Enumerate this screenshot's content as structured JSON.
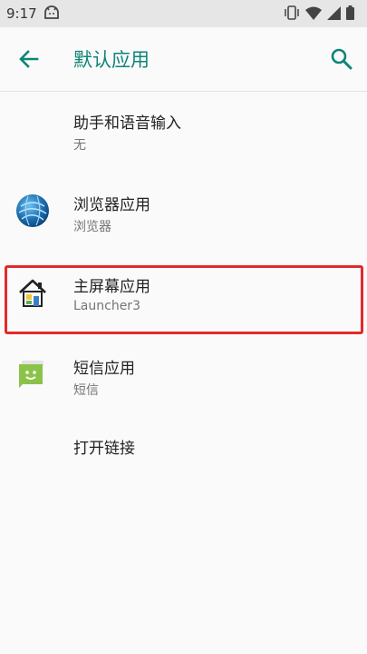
{
  "status_bar": {
    "time": "9:17",
    "icons": [
      "android-debug-icon",
      "vibrate-icon",
      "wifi-icon",
      "signal-icon",
      "battery-icon"
    ]
  },
  "app_bar": {
    "title": "默认应用",
    "back_icon": "arrow-back-icon",
    "search_icon": "search-icon",
    "accent_color": "#0d8577"
  },
  "items": [
    {
      "title": "助手和语音输入",
      "subtitle": "无",
      "icon": "none"
    },
    {
      "title": "浏览器应用",
      "subtitle": "浏览器",
      "icon": "browser-globe-icon"
    },
    {
      "title": "主屏幕应用",
      "subtitle": "Launcher3",
      "icon": "home-icon"
    },
    {
      "title": "短信应用",
      "subtitle": "短信",
      "icon": "sms-icon"
    },
    {
      "title": "打开链接",
      "icon": "none"
    }
  ],
  "highlight_color": "#e22a2a"
}
